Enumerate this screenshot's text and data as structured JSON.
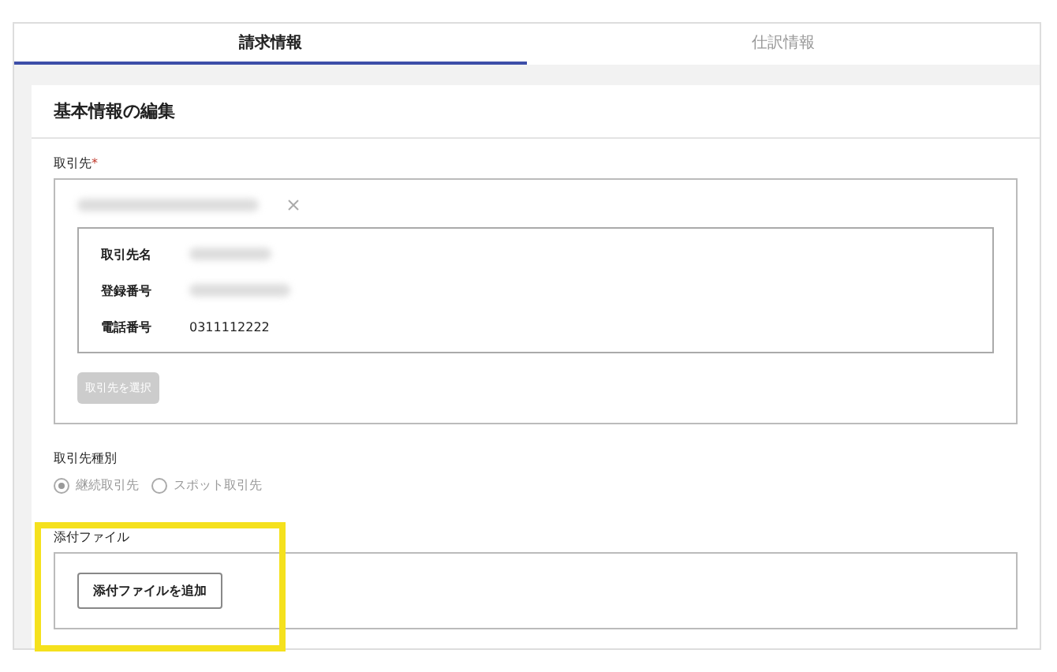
{
  "tabs": [
    {
      "label": "請求情報",
      "selected": true
    },
    {
      "label": "仕訳情報",
      "selected": false
    }
  ],
  "section_title": "基本情報の編集",
  "partner": {
    "label": "取引先",
    "required_mark": "*",
    "chip_blurred": true,
    "details": [
      {
        "label": "取引先名",
        "kind": "blurred"
      },
      {
        "label": "登録番号",
        "kind": "blurred"
      },
      {
        "label": "電話番号",
        "kind": "text",
        "value": "0311112222"
      }
    ],
    "select_button": {
      "label": "取引先を選択",
      "disabled": true
    }
  },
  "partner_type": {
    "label": "取引先種別",
    "disabled": true,
    "options": [
      {
        "label": "継続取引先",
        "selected": true
      },
      {
        "label": "スポット取引先",
        "selected": false
      }
    ]
  },
  "attachments": {
    "label": "添付ファイル",
    "highlighted": true,
    "button": "添付ファイルを追加"
  }
}
